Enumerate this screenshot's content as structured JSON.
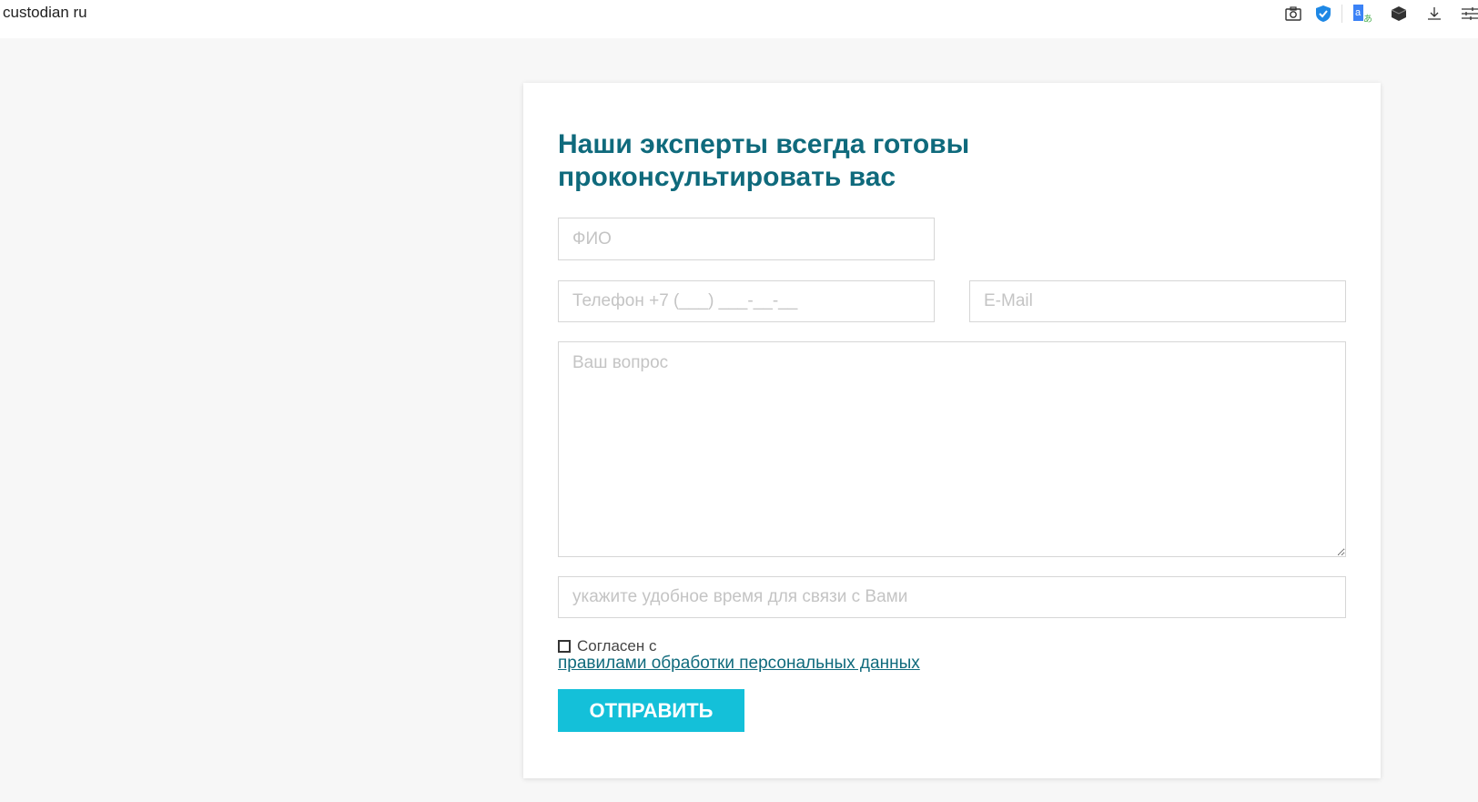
{
  "browser": {
    "title": "custodian ru",
    "icons": [
      "camera-icon",
      "shield-check-icon",
      "translate-icon",
      "cube-icon",
      "download-icon",
      "settings-sliders-icon"
    ]
  },
  "form": {
    "heading": "Наши эксперты всегда готовы проконсультировать вас",
    "name_placeholder": "ФИО",
    "phone_placeholder": "Телефон +7 (___) ___-__-__",
    "email_placeholder": "E-Mail",
    "question_placeholder": "Ваш вопрос",
    "time_placeholder": "укажите удобное время для связи с Вами",
    "agree_label": "Согласен с",
    "policy_link": "правилами обработки персональных данных",
    "submit_label": "ОТПРАВИТЬ"
  },
  "colors": {
    "accent": "#14c0d9",
    "heading": "#0f6a7c"
  }
}
